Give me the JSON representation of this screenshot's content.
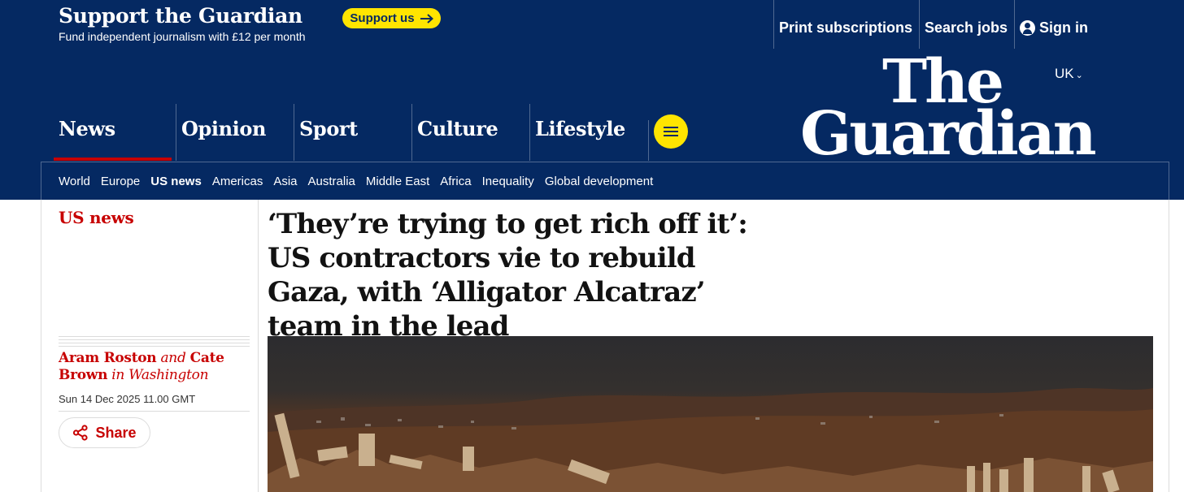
{
  "support": {
    "title": "Support the Guardian",
    "subtitle": "Fund independent journalism with £12 per month",
    "button_label": "Support us",
    "button_icon": "arrow-right-icon"
  },
  "top_links": {
    "print": "Print subscriptions",
    "jobs": "Search jobs",
    "signin": "Sign in"
  },
  "edition": {
    "label": "UK",
    "icon": "chevron-down-icon"
  },
  "logo": {
    "line1": "The",
    "line2": "Guardian"
  },
  "pillars": [
    {
      "label": "News",
      "active": true
    },
    {
      "label": "Opinion"
    },
    {
      "label": "Sport"
    },
    {
      "label": "Culture"
    },
    {
      "label": "Lifestyle"
    }
  ],
  "menu": {
    "icon": "hamburger-menu-icon"
  },
  "subnav": [
    {
      "label": "World"
    },
    {
      "label": "Europe"
    },
    {
      "label": "US news",
      "current": true
    },
    {
      "label": "Americas"
    },
    {
      "label": "Asia"
    },
    {
      "label": "Australia"
    },
    {
      "label": "Middle East"
    },
    {
      "label": "Africa"
    },
    {
      "label": "Inequality"
    },
    {
      "label": "Global development"
    }
  ],
  "article": {
    "section": "US news",
    "headline": "‘They’re trying to get rich off it’: US contractors vie to rebuild Gaza, with ‘Alligator Alcatraz’ team in the lead",
    "byline": {
      "author1": "Aram Roston",
      "conj": "and",
      "author2": "Cate Brown",
      "location": "in Washington"
    },
    "date": "Sun 14 Dec 2025 11.00 GMT",
    "share_label": "Share",
    "share_icon": "share-icon"
  },
  "colors": {
    "brand_blue": "#052962",
    "accent_yellow": "#ffe500",
    "news_red": "#c70000"
  }
}
